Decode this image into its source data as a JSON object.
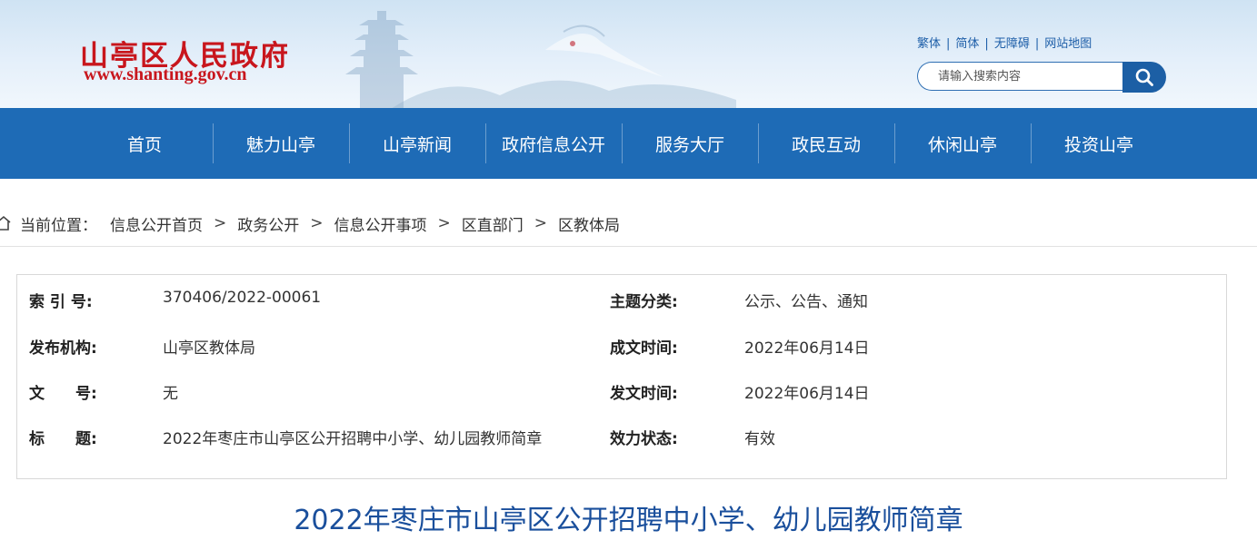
{
  "site": {
    "name": "山亭区人民政府",
    "url": "www.shanting.gov.cn",
    "top_links": [
      "繁体",
      "简体",
      "无障碍",
      "网站地图"
    ]
  },
  "search": {
    "placeholder": "请输入搜索内容",
    "icon": "search-icon"
  },
  "nav": {
    "items": [
      "首页",
      "魅力山亭",
      "山亭新闻",
      "政府信息公开",
      "服务大厅",
      "政民互动",
      "休闲山亭",
      "投资山亭"
    ]
  },
  "breadcrumb": {
    "prefix": "当前位置：",
    "items": [
      "信息公开首页",
      "政务公开",
      "信息公开事项",
      "区直部门",
      "区教体局"
    ],
    "separator": ">"
  },
  "info": {
    "index_label": "索 引 号:",
    "index_value": "370406/2022-00061",
    "topic_label": "主题分类:",
    "topic_value": "公示、公告、通知",
    "publisher_label": "发布机构:",
    "publisher_value": "山亭区教体局",
    "created_label": "成文时间:",
    "created_value": "2022年06月14日",
    "docno_label": "文　　号:",
    "docno_value": "无",
    "published_label": "发文时间:",
    "published_value": "2022年06月14日",
    "title_label": "标　　题:",
    "title_value": "2022年枣庄市山亭区公开招聘中小学、幼儿园教师简章",
    "status_label": "效力状态:",
    "status_value": "有效"
  },
  "article": {
    "title": "2022年枣庄市山亭区公开招聘中小学、幼儿园教师简章"
  },
  "colors": {
    "nav_bg": "#1e6bb6",
    "logo_red": "#c8161d",
    "title_blue": "#1a4f9c",
    "link_blue": "#1d5ea8"
  }
}
